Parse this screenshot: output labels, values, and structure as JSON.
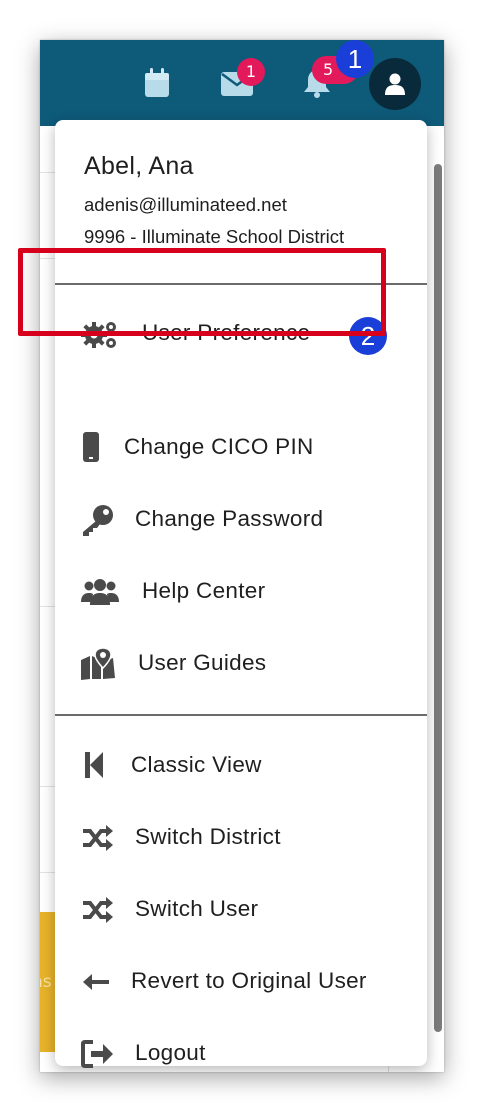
{
  "topbar": {
    "calendar_icon": "calendar-icon",
    "mail_icon": "envelope-icon",
    "mail_badge": "1",
    "bell_icon": "bell-icon",
    "bell_badge": "5",
    "avatar_icon": "user-icon",
    "color": "#0e5a79"
  },
  "callouts": {
    "step1": "1",
    "step2": "2",
    "color": "#1a3ed8",
    "highlight_color": "#d6001c"
  },
  "profile": {
    "name": "Abel, Ana",
    "email": "adenis@illuminateed.net",
    "district": "9996 - Illuminate School District"
  },
  "menu": {
    "group1": [
      {
        "label": "User Preference",
        "icon": "gears-icon"
      },
      {
        "label": "Change CICO PIN",
        "icon": "mobile-phone-icon"
      },
      {
        "label": "Change Password",
        "icon": "key-icon"
      },
      {
        "label": "Help Center",
        "icon": "users-group-icon"
      },
      {
        "label": "User Guides",
        "icon": "map-marker-icon"
      }
    ],
    "group2": [
      {
        "label": "Classic View",
        "icon": "step-backward-icon"
      },
      {
        "label": "Switch District",
        "icon": "shuffle-icon"
      },
      {
        "label": "Switch User",
        "icon": "shuffle-icon"
      },
      {
        "label": "Revert to Original User",
        "icon": "arrow-left-icon"
      },
      {
        "label": "Logout",
        "icon": "sign-out-icon"
      }
    ]
  },
  "background": {
    "partial_text": "ns"
  }
}
